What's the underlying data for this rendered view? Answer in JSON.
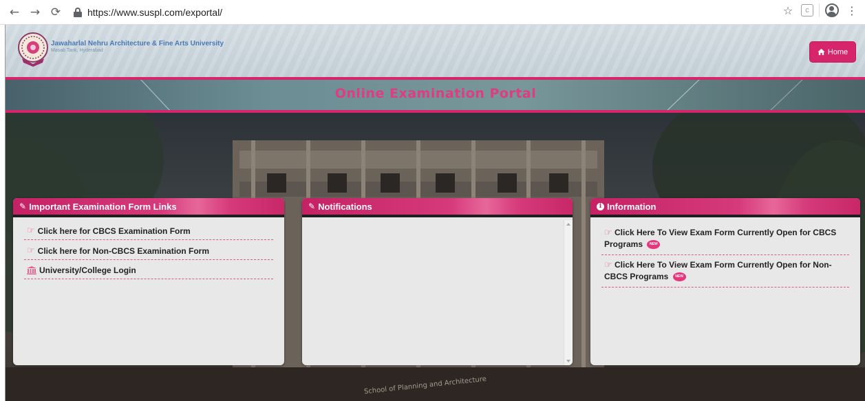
{
  "browser": {
    "url": "https://www.suspl.com/exportal/",
    "icons": [
      "back-icon",
      "forward-icon",
      "reload-icon",
      "lock-icon",
      "star-icon",
      "extension-icon",
      "account-icon",
      "menu-icon"
    ]
  },
  "header": {
    "university_name": "Jawaharlal Nehru Architecture & Fine Arts University",
    "university_location": "Masab Tank, Hyderabad",
    "home_label": "Home"
  },
  "banner": {
    "title": "Online Examination Portal"
  },
  "panels": {
    "links": {
      "title": "Important Examination Form Links",
      "items": [
        "Click here for CBCS Examination Form",
        "Click here for Non-CBCS Examination Form",
        "University/College Login"
      ]
    },
    "notifications": {
      "title": "Notifications"
    },
    "information": {
      "title": "Information",
      "items": [
        "Click Here To View Exam Form Currently Open for CBCS Programs",
        "Click Here To View Exam Form Currently Open for Non-CBCS Programs"
      ],
      "badge_label": "NEW"
    }
  },
  "colors": {
    "accent": "#d6256b",
    "banner_title": "#dd3d82",
    "link_icon": "#e3648f"
  }
}
